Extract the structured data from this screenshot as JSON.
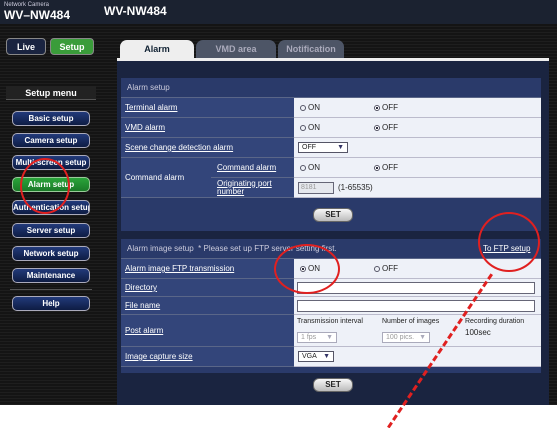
{
  "header": {
    "brand": "Network Camera",
    "model_left": "WV–NW484",
    "model_right": "WV-NW484"
  },
  "top_buttons": {
    "live": "Live",
    "setup": "Setup"
  },
  "sidebar": {
    "title": "Setup menu",
    "items": [
      {
        "label": "Basic setup"
      },
      {
        "label": "Camera setup"
      },
      {
        "label": "Multi-screen setup"
      },
      {
        "label": "Alarm setup"
      },
      {
        "label": "Authentication setup"
      },
      {
        "label": "Server setup"
      },
      {
        "label": "Network setup"
      },
      {
        "label": "Maintenance"
      },
      {
        "label": "Help"
      }
    ]
  },
  "tabs": [
    "Alarm",
    "VMD area",
    "Notification"
  ],
  "alarm_setup": {
    "title": "Alarm setup",
    "terminal_alarm": "Terminal alarm",
    "vmd_alarm": "VMD alarm",
    "scene_change": "Scene change detection alarm",
    "scene_value": "OFF",
    "command_alarm": "Command alarm",
    "command_alarm_sub": "Command alarm",
    "originating_port": "Originating port number",
    "port_value": "8181",
    "port_range": "(1-65535)",
    "on": "ON",
    "off": "OFF",
    "set": "SET"
  },
  "image_setup": {
    "title": "Alarm image setup",
    "note": "* Please set up FTP server setting first.",
    "link": "To FTP setup",
    "ftp_transmission": "Alarm image FTP transmission",
    "directory": "Directory",
    "file_name": "File name",
    "post_alarm": "Post alarm",
    "transmission_interval": "Transmission interval",
    "interval_value": "1 fps",
    "number_of_images": "Number of images",
    "images_value": "100 pics.",
    "recording_duration": "Recording duration",
    "duration_value": "100sec",
    "capture_size": "Image capture size",
    "capture_value": "VGA",
    "on": "ON",
    "off": "OFF",
    "set": "SET"
  },
  "colors": {
    "annotation": "#e02020",
    "active_green": "#2aa43a"
  }
}
